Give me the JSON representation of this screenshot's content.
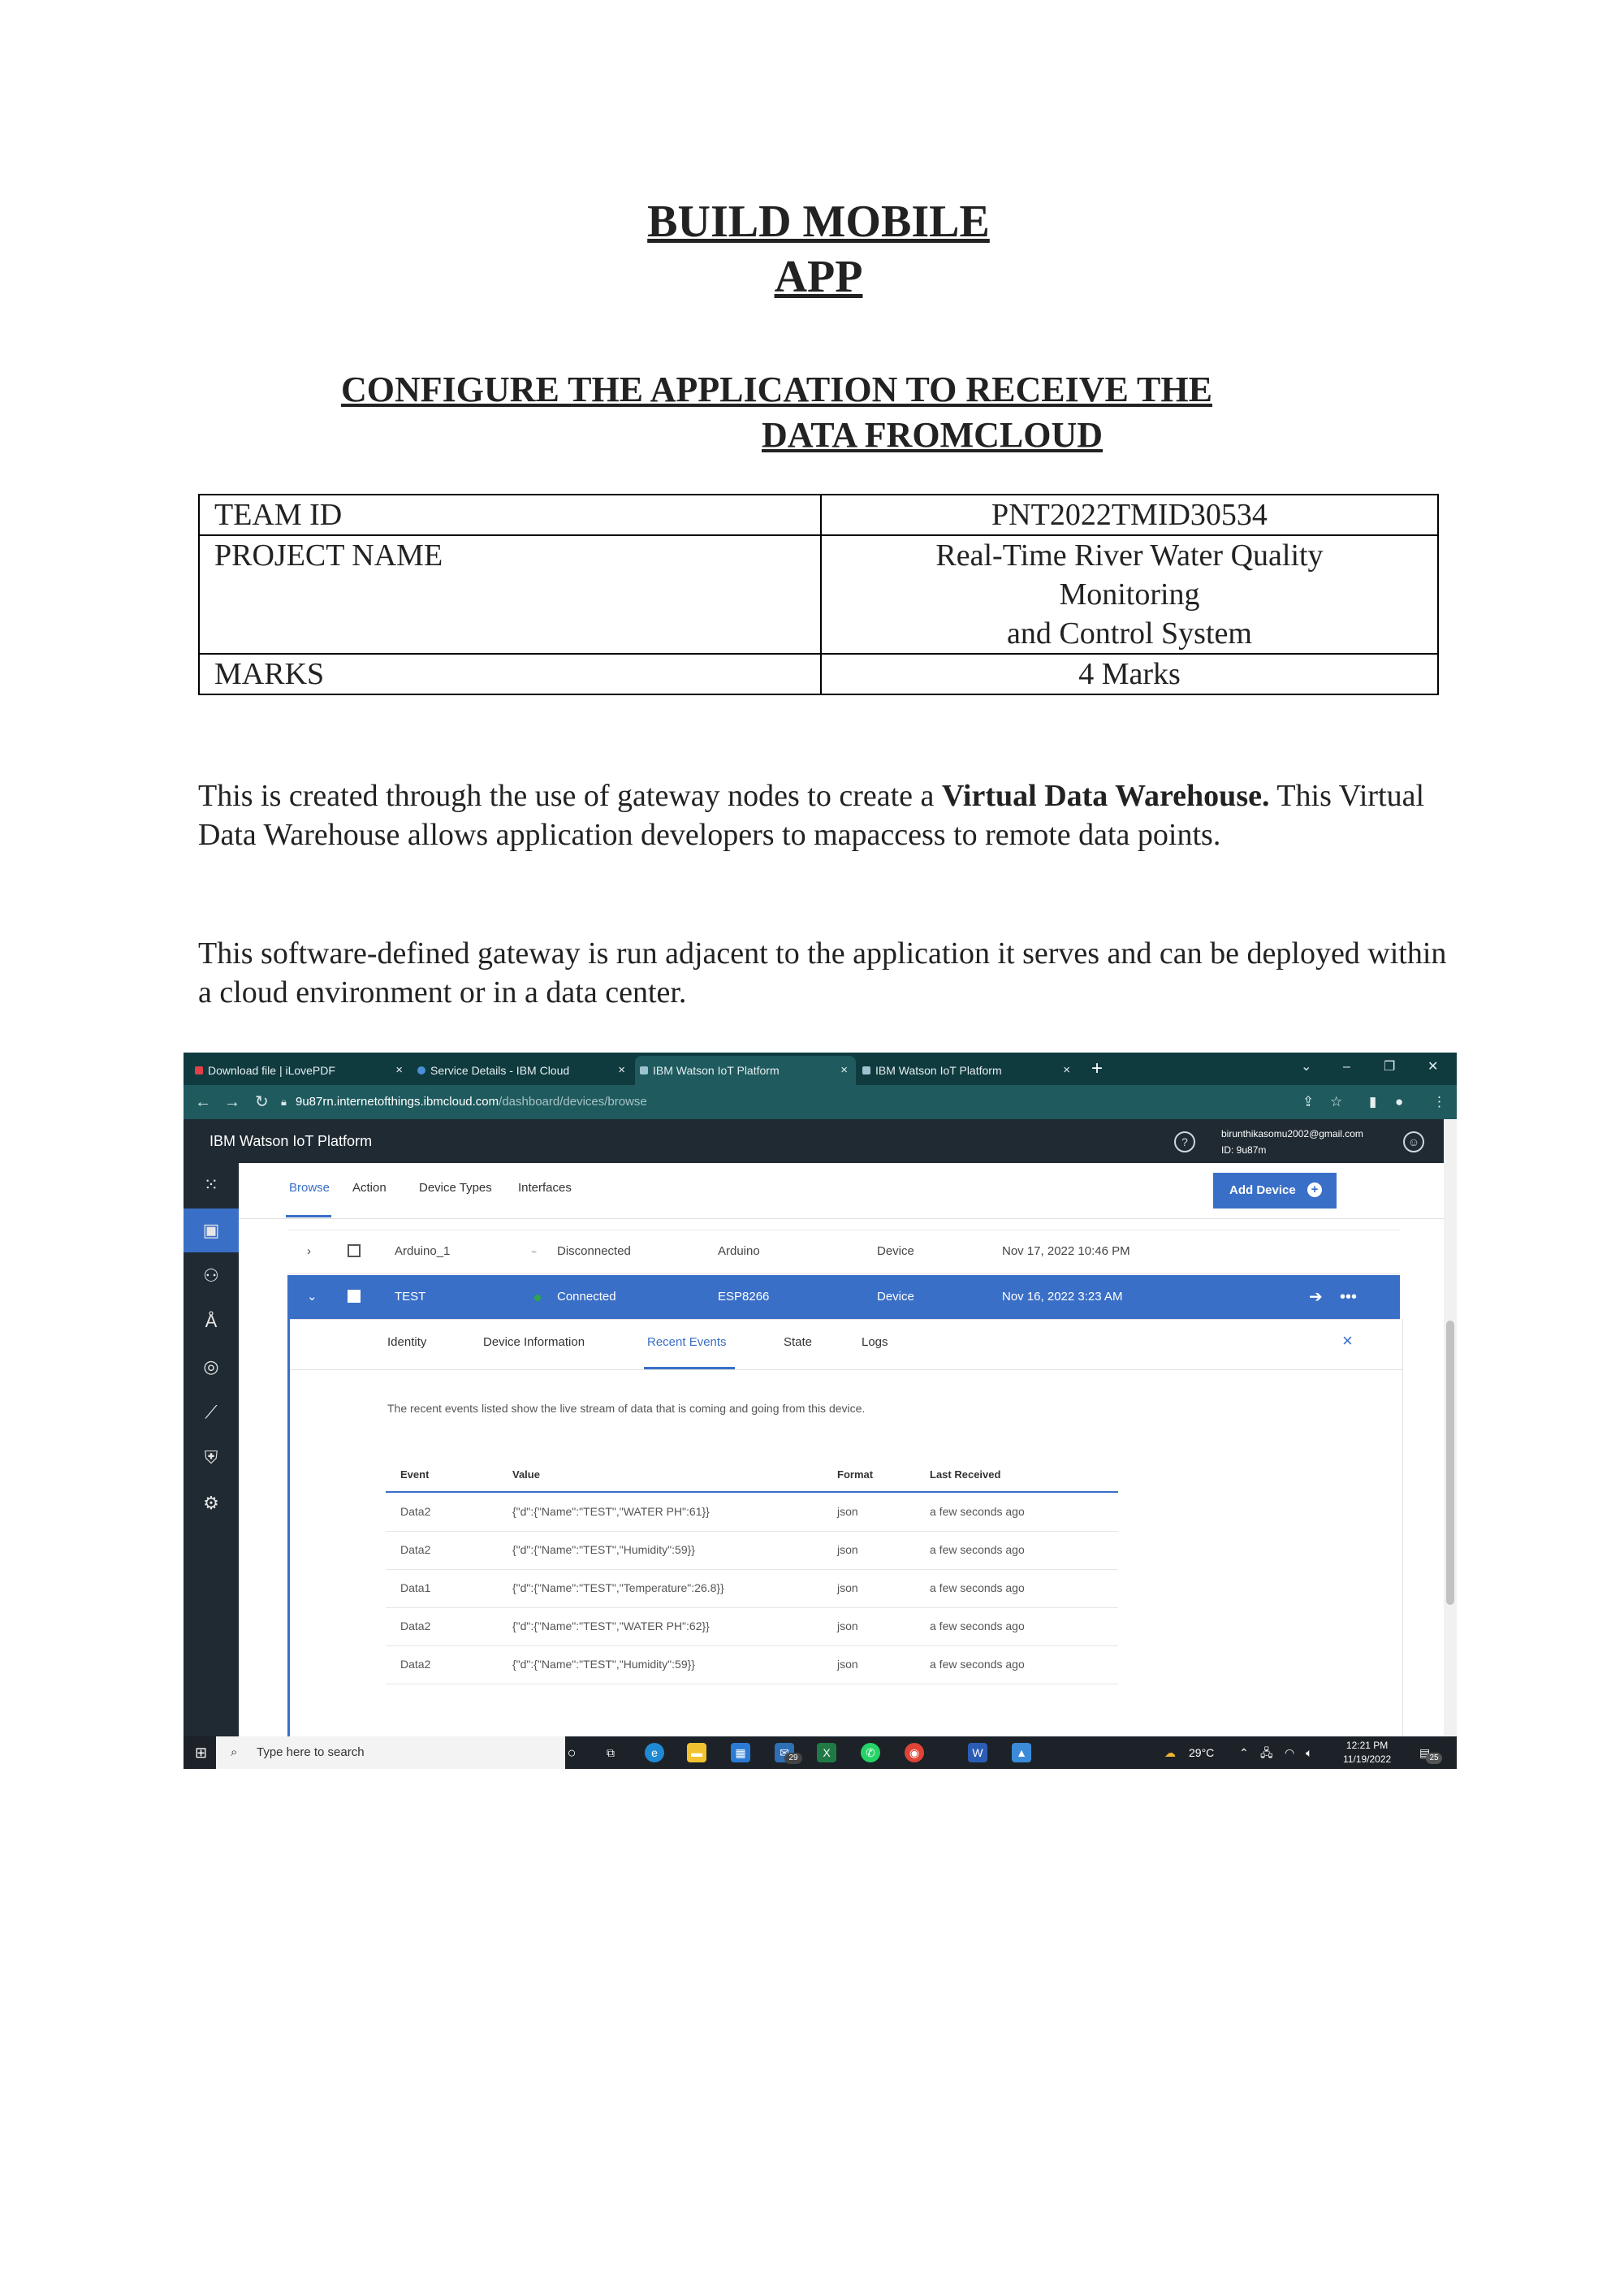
{
  "doc": {
    "title_line1": "BUILD MOBILE",
    "title_line2": "APP",
    "subtitle_line1": "CONFIGURE THE APPLICATION TO RECEIVE THE",
    "subtitle_line2": "DATA FROMCLOUD",
    "table": {
      "team_id_label": "TEAM ID",
      "team_id_value": "PNT2022TMID30534",
      "project_label": "PROJECT NAME",
      "project_value_line1": "Real-Time River Water Quality",
      "project_value_line2": "Monitoring",
      "project_value_line3": "and Control System",
      "marks_label": "MARKS",
      "marks_value": "4 Marks"
    },
    "para1_before": "This is created through the use of gateway nodes to create a ",
    "para1_bold": "Virtual Data Warehouse.",
    "para1_after": "This Virtual Data Warehouse allows application developers to mapaccess to remote data points.",
    "para2": "This software-defined gateway is run adjacent to the application it serves and can be deployed within a cloud environment or in a data center."
  },
  "browser": {
    "tabs": [
      {
        "label": "Download file | iLovePDF",
        "icon": "heart-icon"
      },
      {
        "label": "Service Details - IBM Cloud",
        "icon": "cloud-icon"
      },
      {
        "label": "IBM Watson IoT Platform",
        "icon": "watson-icon"
      },
      {
        "label": "IBM Watson IoT Platform",
        "icon": "watson-icon"
      }
    ],
    "url_host": "9u87rn.internetofthings.ibmcloud.com",
    "url_path": "/dashboard/devices/browse"
  },
  "app": {
    "name": "IBM Watson IoT Platform",
    "account_email": "birunthikasomu2002@gmail.com",
    "account_id": "ID: 9u87m",
    "subnav": [
      "Browse",
      "Action",
      "Device Types",
      "Interfaces"
    ],
    "add_device": "Add Device",
    "devices": [
      {
        "id": "Arduino_1",
        "status": "Disconnected",
        "type": "Arduino",
        "class": "Device",
        "date": "Nov 17, 2022 10:46 PM"
      },
      {
        "id": "TEST",
        "status": "Connected",
        "type": "ESP8266",
        "class": "Device",
        "date": "Nov 16, 2022 3:23 AM"
      }
    ],
    "detail_tabs": [
      "Identity",
      "Device Information",
      "Recent Events",
      "State",
      "Logs"
    ],
    "detail_note": "The recent events listed show the live stream of data that is coming and going from this device.",
    "event_headers": {
      "event": "Event",
      "value": "Value",
      "format": "Format",
      "last": "Last Received"
    },
    "events": [
      {
        "event": "Data2",
        "value": "{\"d\":{\"Name\":\"TEST\",\"WATER PH\":61}}",
        "format": "json",
        "last": "a few seconds ago"
      },
      {
        "event": "Data2",
        "value": "{\"d\":{\"Name\":\"TEST\",\"Humidity\":59}}",
        "format": "json",
        "last": "a few seconds ago"
      },
      {
        "event": "Data1",
        "value": "{\"d\":{\"Name\":\"TEST\",\"Temperature\":26.8}}",
        "format": "json",
        "last": "a few seconds ago"
      },
      {
        "event": "Data2",
        "value": "{\"d\":{\"Name\":\"TEST\",\"WATER PH\":62}}",
        "format": "json",
        "last": "a few seconds ago"
      },
      {
        "event": "Data2",
        "value": "{\"d\":{\"Name\":\"TEST\",\"Humidity\":59}}",
        "format": "json",
        "last": "a few seconds ago"
      }
    ]
  },
  "taskbar": {
    "search_placeholder": "Type here to search",
    "weather": "29°C",
    "time": "12:21 PM",
    "date": "11/19/2022",
    "mail_badge": "29",
    "notif_badge": "25"
  },
  "colors": {
    "accent": "#3a6fc7",
    "browser_bar": "#0f3b3f",
    "app_bar": "#1f2a32",
    "connected": "#2aa84a"
  }
}
